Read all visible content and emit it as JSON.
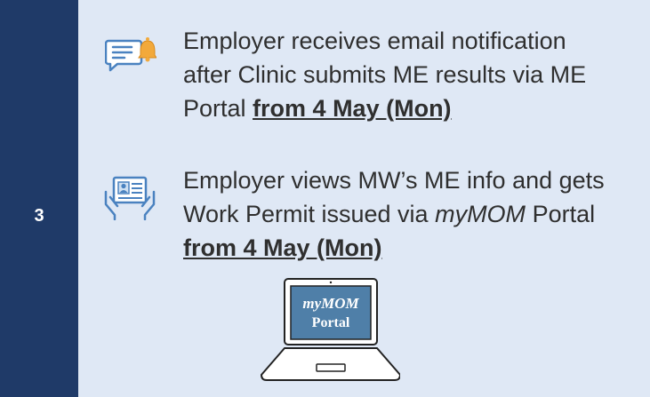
{
  "step": {
    "number": "3"
  },
  "items": [
    {
      "icon": "chat-bell-icon",
      "line1": "Employer receives email notification",
      "line2": "after Clinic submits ME results via ME",
      "line3_prefix": "Portal ",
      "line3_bold": "from 4 May (Mon)"
    },
    {
      "icon": "id-card-hands-icon",
      "line1": "Employer views MW’s ME info and gets",
      "line2_prefix": "Work Permit issued via ",
      "line2_italic": "myMOM",
      "line2_suffix": " Portal",
      "line3_bold": "from 4 May (Mon)"
    }
  ],
  "laptop": {
    "screen_line1": "myMOM",
    "screen_line2": "Portal"
  },
  "colors": {
    "step_column": "#1f3a68",
    "panel": "#dfe8f5",
    "icon_blue": "#4a82c0",
    "bell_orange": "#f2a93b",
    "screen": "#4f7fa8"
  }
}
